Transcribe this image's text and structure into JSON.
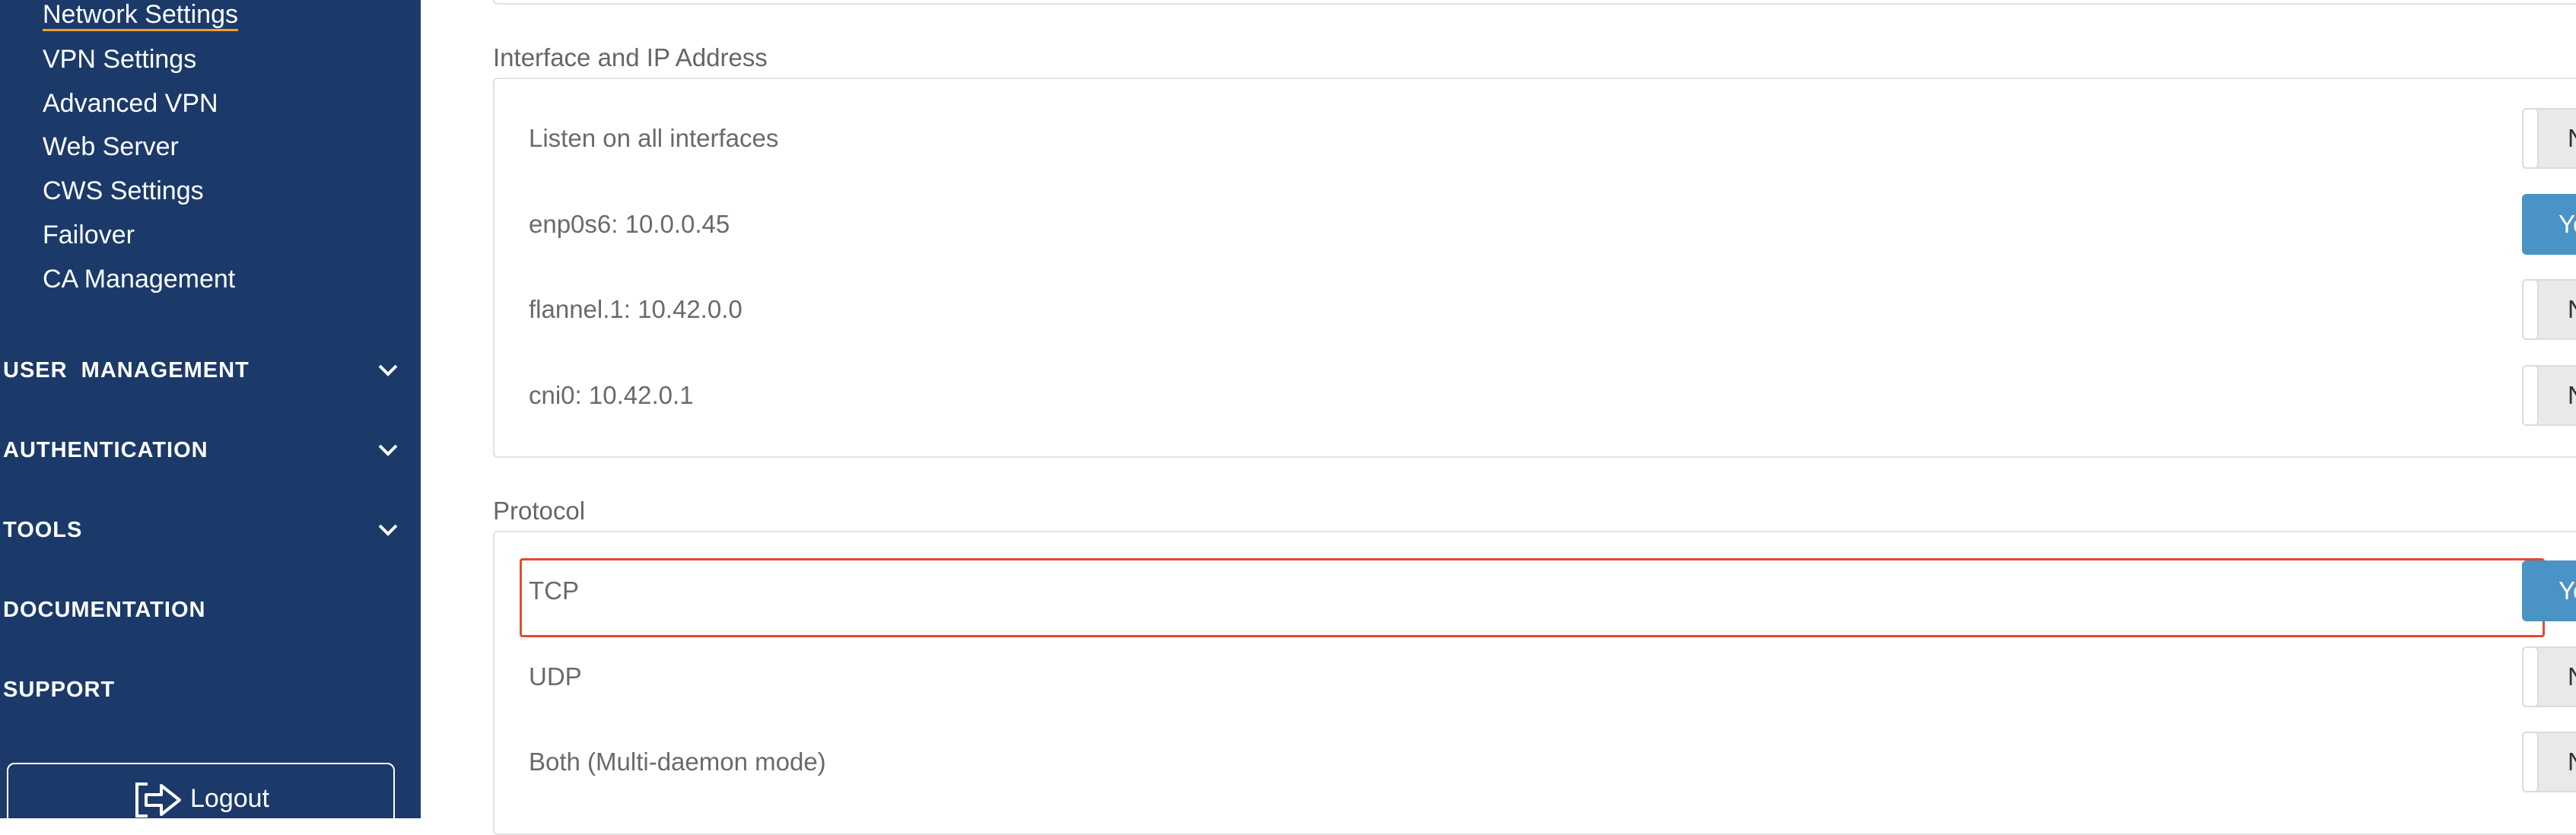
{
  "sidebar": {
    "subnav": [
      {
        "label": "Network Settings",
        "active": true
      },
      {
        "label": "VPN Settings"
      },
      {
        "label": "Advanced VPN"
      },
      {
        "label": "Web Server"
      },
      {
        "label": "CWS Settings"
      },
      {
        "label": "Failover"
      },
      {
        "label": "CA Management"
      }
    ],
    "sections": [
      {
        "label": "USER  MANAGEMENT",
        "icon": "chevron-down-icon"
      },
      {
        "label": "AUTHENTICATION",
        "icon": "chevron-down-icon"
      },
      {
        "label": "TOOLS",
        "icon": "chevron-down-icon"
      },
      {
        "label": "DOCUMENTATION"
      },
      {
        "label": "SUPPORT"
      }
    ],
    "logout": {
      "label": "Logout",
      "icon": "logout-icon"
    }
  },
  "main": {
    "interface_group": {
      "title": "Interface and IP Address",
      "rows": [
        {
          "label": "Listen on all interfaces",
          "value": "No"
        },
        {
          "label": "enp0s6: 10.0.0.45",
          "value": "Yes"
        },
        {
          "label": "flannel.1: 10.42.0.0",
          "value": "No"
        },
        {
          "label": "cni0: 10.42.0.1",
          "value": "No"
        }
      ]
    },
    "protocol_group": {
      "title": "Protocol",
      "rows": [
        {
          "label": "TCP",
          "value": "Yes"
        },
        {
          "label": "UDP",
          "value": "No"
        },
        {
          "label": "Both (Multi-daemon mode)",
          "value": "No"
        }
      ]
    }
  },
  "colors": {
    "sidebar_bg": "#1b3a6a",
    "active_underline": "#f0a030",
    "toggle_on": "#4a93c6",
    "highlight": "#e24a2f"
  }
}
